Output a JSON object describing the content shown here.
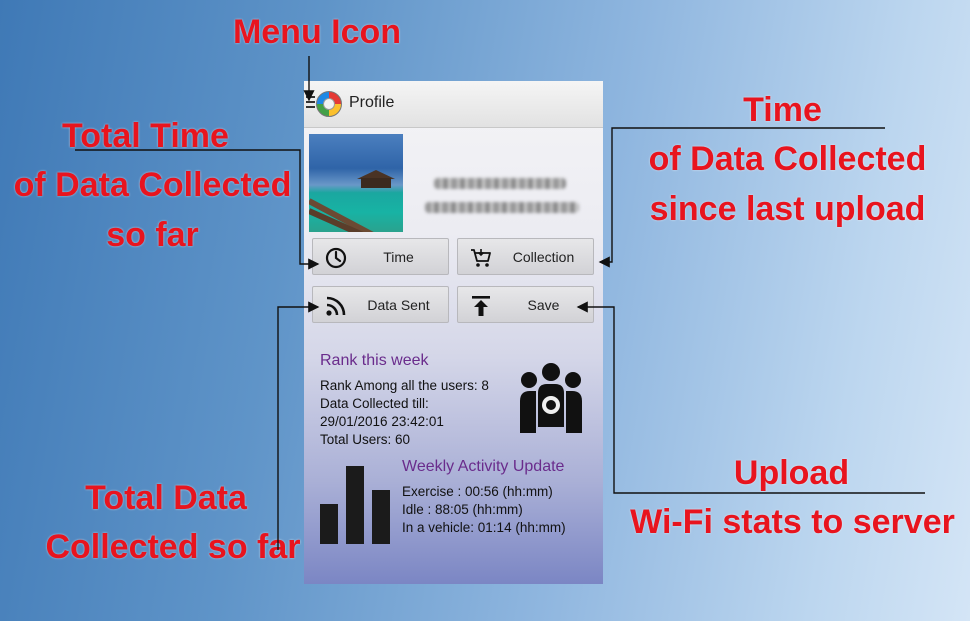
{
  "callouts": {
    "menu_icon": "Menu Icon",
    "total_time": [
      "Total Time",
      "of Data Collected",
      "so far"
    ],
    "time_since_upload": [
      "Time",
      "of Data Collected",
      "since last upload"
    ],
    "total_data": [
      "Total Data",
      "Collected so far"
    ],
    "upload": [
      "Upload",
      "Wi-Fi stats to server"
    ]
  },
  "app": {
    "title": "Profile",
    "buttons": {
      "time": "Time",
      "collection": "Collection",
      "data_sent": "Data Sent",
      "save": "Save"
    },
    "rank": {
      "title": "Rank this week",
      "lines": [
        "Rank Among all the users: 8",
        "Data Collected till:",
        "29/01/2016 23:42:01",
        "Total Users: 60"
      ]
    },
    "weekly": {
      "title": "Weekly Activity Update",
      "lines": [
        "Exercise : 00:56 (hh:mm)",
        "Idle : 88:05 (hh:mm)",
        "In a vehicle: 01:14 (hh:mm)"
      ]
    }
  },
  "colors": {
    "callout_text": "#e8141e",
    "section_title": "#6a2c8c"
  },
  "icons": {
    "menu": "hamburger-menu-icon",
    "logo": "app-logo-icon",
    "time": "clock-icon",
    "collection": "shopping-cart-icon",
    "data_sent": "rss-signal-icon",
    "save": "upload-arrow-icon",
    "rank": "people-group-icon",
    "weekly": "bar-chart-icon"
  }
}
